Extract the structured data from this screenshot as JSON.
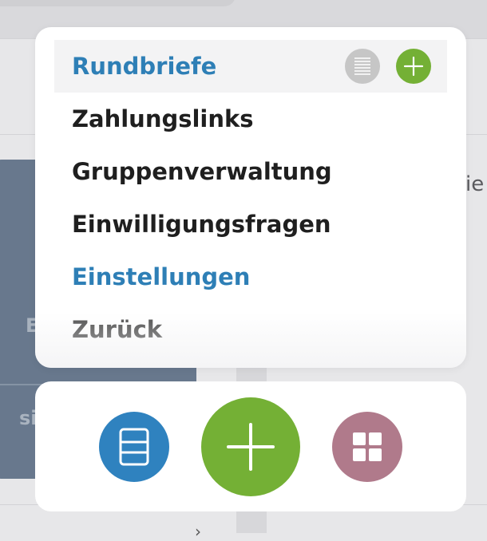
{
  "background": {
    "card_text_1": "E",
    "card_text_2": "si",
    "right_text": "ie",
    "chevron": "›"
  },
  "menu": {
    "items": [
      {
        "label": "Rundbriefe",
        "state": "active"
      },
      {
        "label": "Zahlungslinks"
      },
      {
        "label": "Gruppenverwaltung"
      },
      {
        "label": "Einwilligungsfragen"
      },
      {
        "label": "Einstellungen"
      },
      {
        "label": "Zurück"
      }
    ],
    "row_actions": {
      "list_icon": "list-icon",
      "add_icon": "plus-icon"
    }
  },
  "dock": {
    "buttons": [
      {
        "icon": "document-icon",
        "color": "#2f82bf"
      },
      {
        "icon": "plus-icon",
        "color": "#74b035"
      },
      {
        "icon": "grid-icon",
        "color": "#b07a8b"
      }
    ]
  },
  "colors": {
    "accent_blue": "#2e7fb6",
    "accent_green": "#74b035",
    "accent_mauve": "#b07a8b",
    "text_dark": "#1f1f1f"
  }
}
